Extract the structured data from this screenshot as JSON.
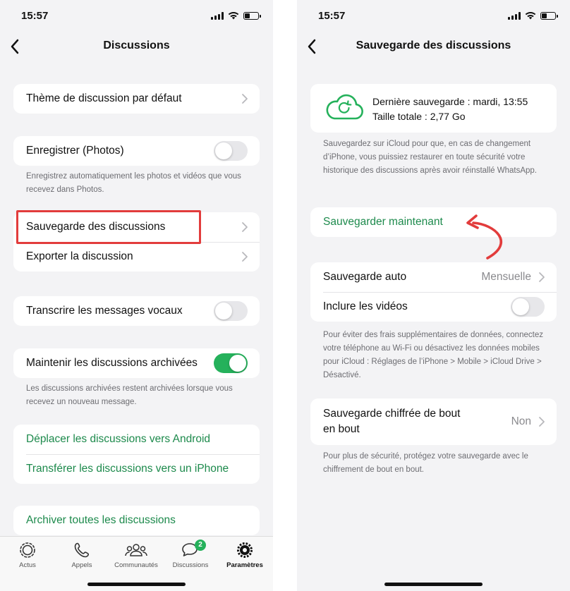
{
  "left": {
    "status": {
      "time": "15:57"
    },
    "nav": {
      "title": "Discussions"
    },
    "rows": {
      "theme": "Thème de discussion par défaut",
      "save_photos": "Enregistrer (Photos)",
      "save_photos_note": "Enregistrez automatiquement les photos et vidéos que vous recevez dans Photos.",
      "backup": "Sauvegarde des discussions",
      "export": "Exporter la discussion",
      "transcribe": "Transcrire les messages vocaux",
      "keep_archived": "Maintenir les discussions archivées",
      "keep_archived_note": "Les discussions archivées restent archivées lorsque vous recevez un nouveau message.",
      "move_android": "Déplacer les discussions vers Android",
      "transfer_iphone": "Transférer les discussions vers un iPhone",
      "archive_all": "Archiver toutes les discussions"
    },
    "toggles": {
      "save_photos": false,
      "transcribe": false,
      "keep_archived": true
    },
    "tabs": [
      {
        "label": "Actus",
        "icon": "updates-icon"
      },
      {
        "label": "Appels",
        "icon": "phone-icon"
      },
      {
        "label": "Communautés",
        "icon": "communities-icon"
      },
      {
        "label": "Discussions",
        "icon": "chat-bubbles-icon",
        "badge": "2"
      },
      {
        "label": "Paramètres",
        "icon": "gear-icon",
        "active": true
      }
    ]
  },
  "right": {
    "status": {
      "time": "15:57"
    },
    "nav": {
      "title": "Sauvegarde des discussions"
    },
    "backup_info": {
      "last_backup": "Dernière sauvegarde : mardi, 13:55",
      "total_size": "Taille totale : 2,77 Go",
      "icon": "cloud-sync-icon"
    },
    "icloud_note": "Sauvegardez sur iCloud pour que, en cas de changement d’iPhone, vous puissiez restaurer en toute sécurité votre historique des discussions après avoir réinstallé WhatsApp.",
    "backup_now": "Sauvegarder maintenant",
    "auto_backup": {
      "label": "Sauvegarde auto",
      "value": "Mensuelle"
    },
    "include_videos": {
      "label": "Inclure les vidéos",
      "on": false
    },
    "data_note": "Pour éviter des frais supplémentaires de données, connectez votre téléphone au Wi-Fi ou désactivez les données mobiles pour iCloud : Réglages de l’iPhone > Mobile > iCloud Drive > Désactivé.",
    "encrypted": {
      "label": "Sauvegarde chiffrée de bout en bout",
      "value": "Non"
    },
    "encrypted_note": "Pour plus de sécurité, protégez votre sauvegarde avec le chiffrement de bout en bout."
  },
  "colors": {
    "accent": "#1d8a4c",
    "toggle_on": "#25b15b",
    "highlight": "#e23c3c",
    "arrow": "#e23c3c"
  }
}
